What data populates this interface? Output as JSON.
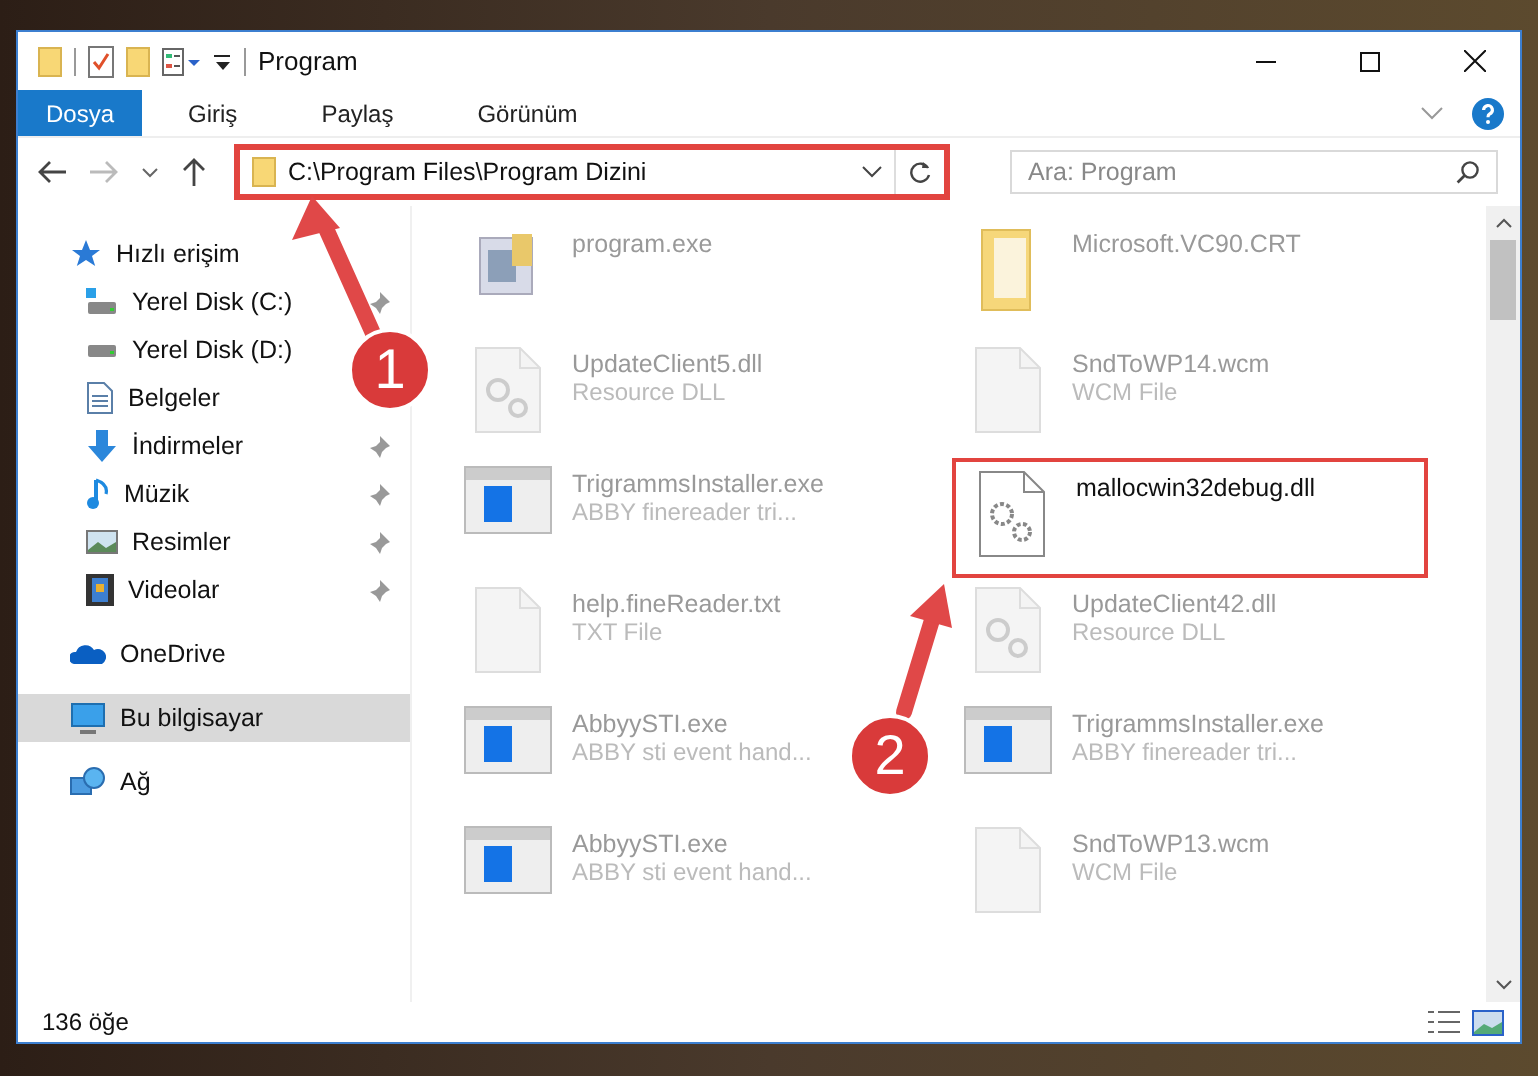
{
  "window": {
    "title": "Program"
  },
  "ribbon_tabs": [
    {
      "label": "Dosya",
      "selected": true
    },
    {
      "label": "Giriş",
      "selected": false
    },
    {
      "label": "Paylaş",
      "selected": false
    },
    {
      "label": "Görünüm",
      "selected": false
    }
  ],
  "address_bar": {
    "path": "C:\\Program Files\\Program Dizini",
    "highlighted": true
  },
  "search": {
    "placeholder": "Ara: Program"
  },
  "sidebar": {
    "items": [
      {
        "label": "Hızlı erişim",
        "kind": "star",
        "selected": false,
        "children": [
          {
            "label": "Yerel Disk (C:)",
            "kind": "drive-c",
            "pinned": true,
            "selected": false
          },
          {
            "label": "Yerel Disk (D:)",
            "kind": "drive",
            "selected": false
          },
          {
            "label": "Belgeler",
            "kind": "documents",
            "selected": false
          },
          {
            "label": "İndirmeler",
            "kind": "downloads",
            "pinned": true,
            "selected": false
          },
          {
            "label": "Müzik",
            "kind": "music",
            "pinned": true,
            "selected": false
          },
          {
            "label": "Resimler",
            "kind": "pictures",
            "pinned": true,
            "selected": false
          },
          {
            "label": "Videolar",
            "kind": "videos",
            "pinned": true,
            "selected": false
          }
        ]
      },
      {
        "label": "OneDrive",
        "kind": "cloud",
        "selected": false
      },
      {
        "label": "Bu bilgisayar",
        "kind": "pc",
        "selected": true
      },
      {
        "label": "Ağ",
        "kind": "network",
        "selected": false
      }
    ]
  },
  "files": [
    {
      "name": "program.exe",
      "kind": "app",
      "highlighted": false
    },
    {
      "name": "Microsoft.VC90.CRT",
      "kind": "folder",
      "highlighted": false
    },
    {
      "name": "UpdateClient5.dll",
      "type": "Resource DLL",
      "kind": "dll",
      "highlighted": false
    },
    {
      "name": "SndToWP14.wcm",
      "type": "WCM File",
      "kind": "file",
      "highlighted": false
    },
    {
      "name": "TrigrammsInstaller.exe",
      "type": "ABBY finereader tri...",
      "kind": "installer",
      "highlighted": false
    },
    {
      "name": "mallocwin32debug.dll",
      "kind": "gears",
      "highlighted": true
    },
    {
      "name": "help.fineReader.txt",
      "type": "TXT File",
      "kind": "file",
      "highlighted": false
    },
    {
      "name": "UpdateClient42.dll",
      "type": "Resource DLL",
      "kind": "dll",
      "highlighted": false
    },
    {
      "name": "AbbyySTI.exe",
      "type": "ABBY sti event hand...",
      "kind": "installer",
      "highlighted": false
    },
    {
      "name": "TrigrammsInstaller.exe",
      "type": "ABBY finereader tri...",
      "kind": "installer",
      "highlighted": false
    },
    {
      "name": "AbbyySTI.exe",
      "type": "ABBY sti event hand...",
      "kind": "installer",
      "highlighted": false
    },
    {
      "name": "SndToWP13.wcm",
      "type": "WCM File",
      "kind": "file",
      "highlighted": false
    }
  ],
  "status_bar": {
    "item_count": "136 öğe"
  },
  "callouts": [
    {
      "number": "1"
    },
    {
      "number": "2"
    }
  ]
}
